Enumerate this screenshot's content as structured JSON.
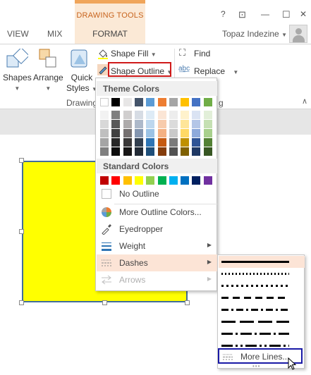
{
  "ribbon_tabs": {
    "context_title": "DRAWING TOOLS",
    "view": "VIEW",
    "mix": "MIX",
    "format": "FORMAT"
  },
  "window": {
    "help": "?",
    "restore": "⊡",
    "minimize": "—",
    "close": "✕"
  },
  "user": {
    "name": "Topaz Indezine"
  },
  "ribbon": {
    "shapes": "Shapes",
    "arrange": "Arrange",
    "quick_styles_line1": "Quick",
    "quick_styles_line2": "Styles",
    "shape_fill": "Shape Fill",
    "shape_outline": "Shape Outline",
    "find": "Find",
    "replace": "Replace",
    "group_drawing": "Drawing",
    "group_editing_tail": "g"
  },
  "menu": {
    "theme_colors_header": "Theme Colors",
    "standard_colors_header": "Standard Colors",
    "theme_top_row": [
      "#ffffff",
      "#000000",
      "#e7e6e6",
      "#44546a",
      "#5b9bd5",
      "#ed7d31",
      "#a5a5a5",
      "#ffc000",
      "#4472c4",
      "#70ad47"
    ],
    "theme_shades": [
      [
        "#f2f2f2",
        "#7f7f7f",
        "#d0cece",
        "#d6dce4",
        "#deebf6",
        "#fbe5d5",
        "#ededed",
        "#fff2cc",
        "#dae3f3",
        "#e2efd9"
      ],
      [
        "#d8d8d8",
        "#595959",
        "#aeabab",
        "#adb9ca",
        "#bdd7ee",
        "#f7cbac",
        "#dbdbdb",
        "#fee599",
        "#b4c6e7",
        "#c5e0b3"
      ],
      [
        "#bfbfbf",
        "#3f3f3f",
        "#757070",
        "#8496b0",
        "#9cc3e5",
        "#f4b183",
        "#c9c9c9",
        "#ffd966",
        "#8eaadb",
        "#a8d08d"
      ],
      [
        "#a5a5a5",
        "#262626",
        "#3a3838",
        "#323f4f",
        "#2e75b5",
        "#c55a11",
        "#7b7b7b",
        "#bf9000",
        "#2f5496",
        "#538135"
      ],
      [
        "#7f7f7f",
        "#0c0c0c",
        "#171616",
        "#222a35",
        "#1e4e79",
        "#843c0b",
        "#525252",
        "#7f6000",
        "#1f3864",
        "#375623"
      ]
    ],
    "standard_colors": [
      "#c00000",
      "#ff0000",
      "#ffc000",
      "#ffff00",
      "#92d050",
      "#00b050",
      "#00b0f0",
      "#0070c0",
      "#002060",
      "#7030a0"
    ],
    "no_outline": "No Outline",
    "more_outline_colors": "More Outline Colors...",
    "eyedropper": "Eyedropper",
    "weight": "Weight",
    "dashes": "Dashes",
    "arrows": "Arrows"
  },
  "submenu": {
    "more_lines": "More Lines..."
  }
}
